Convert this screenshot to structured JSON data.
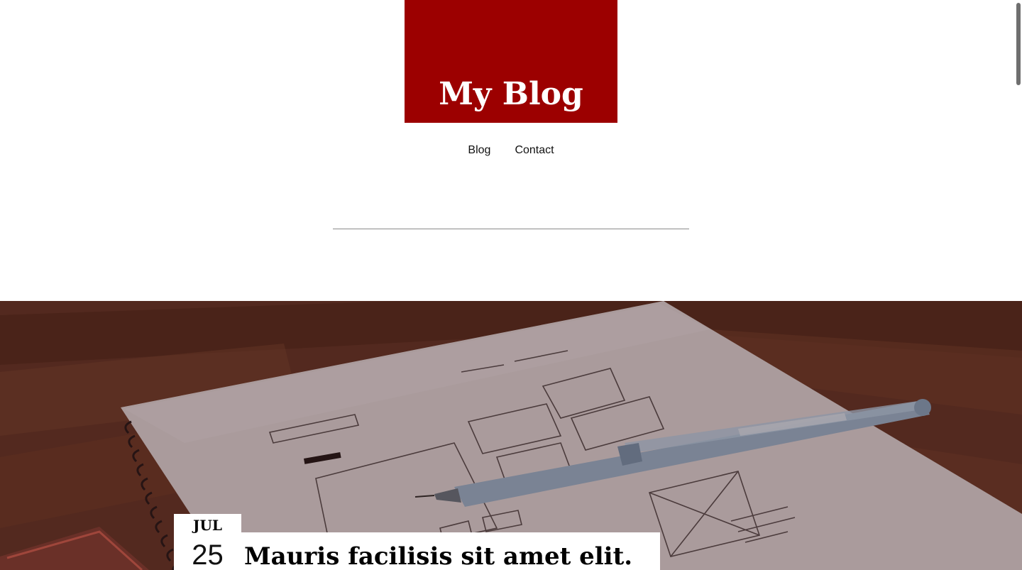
{
  "header": {
    "site_title": "My Blog",
    "brand_color": "#9c0000"
  },
  "nav": {
    "items": [
      {
        "label": "Blog"
      },
      {
        "label": "Contact"
      }
    ]
  },
  "featured_post": {
    "date_month": "JUL",
    "date_day": "25",
    "title": "Mauris facilisis sit amet elit.",
    "image_icon": "notebook-sketch-photo"
  }
}
